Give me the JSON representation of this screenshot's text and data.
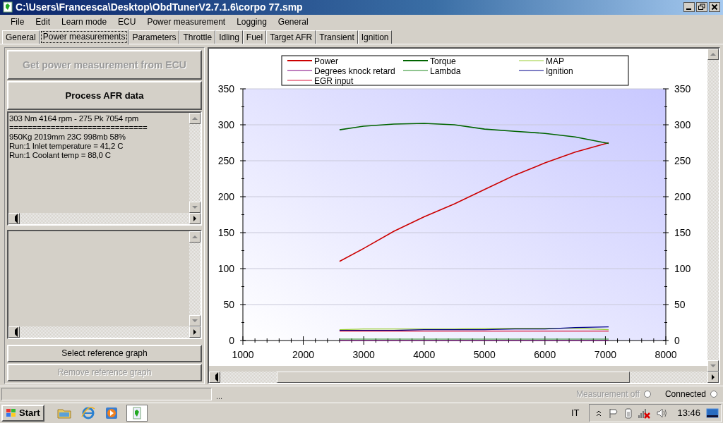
{
  "window": {
    "title": "C:\\Users\\Francesca\\Desktop\\ObdTunerV2.7.1.6\\corpo 77.smp"
  },
  "menu": [
    "File",
    "Edit",
    "Learn mode",
    "ECU",
    "Power measurement",
    "Logging",
    "General"
  ],
  "tabs": [
    {
      "label": "General",
      "selected": false
    },
    {
      "label": "Power measurements",
      "selected": true
    },
    {
      "label": "Parameters",
      "selected": false
    },
    {
      "label": "Throttle",
      "selected": false
    },
    {
      "label": "Idling",
      "selected": false
    },
    {
      "label": "Fuel",
      "selected": false
    },
    {
      "label": "Target AFR",
      "selected": false
    },
    {
      "label": "Transient",
      "selected": false
    },
    {
      "label": "Ignition",
      "selected": false
    }
  ],
  "top_buttons": [
    {
      "label": "Get power measurement from ECU",
      "disabled": true
    },
    {
      "label": "Process AFR data",
      "disabled": false
    }
  ],
  "log": [
    "303 Nm 4164 rpm - 275 Pk 7054 rpm",
    "==============================",
    "950Kg 2019mm 23C 998mb 58%",
    "Run:1 Inlet temperature = 41,2 C",
    "Run:1 Coolant temp = 88,0 C"
  ],
  "bottom_buttons": [
    {
      "label": "Select reference graph",
      "disabled": false
    },
    {
      "label": "Remove reference graph",
      "disabled": true
    }
  ],
  "chart": {
    "chart_data": {
      "type": "line",
      "x": [
        2600,
        3000,
        3500,
        4000,
        4500,
        5000,
        5500,
        6000,
        6500,
        7054
      ],
      "xlim": [
        1000,
        8000
      ],
      "ylim": [
        0,
        350
      ],
      "xticks": [
        1000,
        2000,
        3000,
        4000,
        5000,
        6000,
        7000,
        8000
      ],
      "yticks": [
        0,
        50,
        100,
        150,
        200,
        250,
        300,
        350
      ],
      "y2ticks": [
        0,
        50,
        100,
        150,
        200,
        250,
        300,
        350
      ],
      "y2lim": [
        0,
        350
      ],
      "grid": true,
      "legend": "top",
      "series": [
        {
          "name": "Power",
          "color": "#cc0000",
          "values": [
            110,
            128,
            152,
            172,
            190,
            210,
            230,
            247,
            262,
            275
          ]
        },
        {
          "name": "Torque",
          "color": "#006400",
          "values": [
            293,
            298,
            301,
            302,
            300,
            294,
            291,
            288,
            283,
            274
          ]
        },
        {
          "name": "MAP",
          "color": "#9acd32",
          "values": [
            15,
            16,
            16,
            16,
            16,
            17,
            17,
            17,
            17,
            15
          ]
        },
        {
          "name": "Degrees knock retard",
          "color": "#800080",
          "values": [
            0,
            0,
            0,
            0,
            0,
            0,
            0,
            0,
            0,
            0
          ]
        },
        {
          "name": "Lambda",
          "color": "#228b22",
          "values": [
            2,
            2,
            2,
            2,
            2,
            2,
            2,
            2,
            2,
            2
          ]
        },
        {
          "name": "Ignition",
          "color": "#00008b",
          "values": [
            14,
            14,
            14,
            15,
            15,
            15,
            16,
            16,
            18,
            19
          ]
        },
        {
          "name": "EGR input",
          "color": "#dc143c",
          "values": [
            13,
            13,
            13,
            13,
            13,
            13,
            13,
            13,
            13,
            13
          ]
        }
      ]
    }
  },
  "status": {
    "progress": {
      "level": 0
    },
    "progress_text": "...",
    "indicators": [
      {
        "label": "Measurement off",
        "disabled": true,
        "checked": false
      },
      {
        "label": "Connected",
        "disabled": false,
        "checked": false
      }
    ]
  },
  "taskbar": {
    "start": "Start",
    "language": "IT",
    "clock": "13:46"
  }
}
